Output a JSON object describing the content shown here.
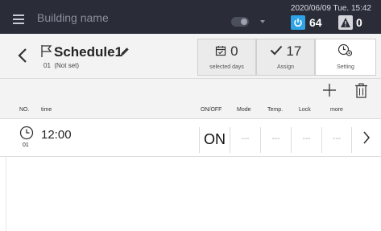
{
  "header": {
    "building_name": "Building name",
    "datetime": "2020/06/09 Tue. 15:42",
    "power_count": "64",
    "alert_count": "0"
  },
  "schedule": {
    "title": "Schedule1",
    "number": "01",
    "subtitle_status": "(Not set)",
    "selected_days_value": "0",
    "selected_days_label": "selected days",
    "assign_value": "17",
    "assign_label": "Assign",
    "setting_label": "Setting"
  },
  "columns": [
    "NO.",
    "time",
    "ON/OFF",
    "Mode",
    "Temp.",
    "Lock",
    "more"
  ],
  "rows": [
    {
      "no": "01",
      "time": "12:00",
      "on_off": "ON",
      "mode": "---",
      "temp": "---",
      "lock": "---",
      "more": "---"
    }
  ],
  "colors": {
    "header_bg": "#2a2d38",
    "power_badge": "#2ea3e6",
    "panel_bg": "#f3f3f3"
  },
  "icons": [
    "menu-icon",
    "toggle-icon",
    "power-icon",
    "alert-icon",
    "back-icon",
    "flag-icon",
    "pencil-icon",
    "calendar-icon",
    "check-icon",
    "clock-gear-icon",
    "plus-icon",
    "trash-icon",
    "clock-icon",
    "chevron-right-icon"
  ]
}
